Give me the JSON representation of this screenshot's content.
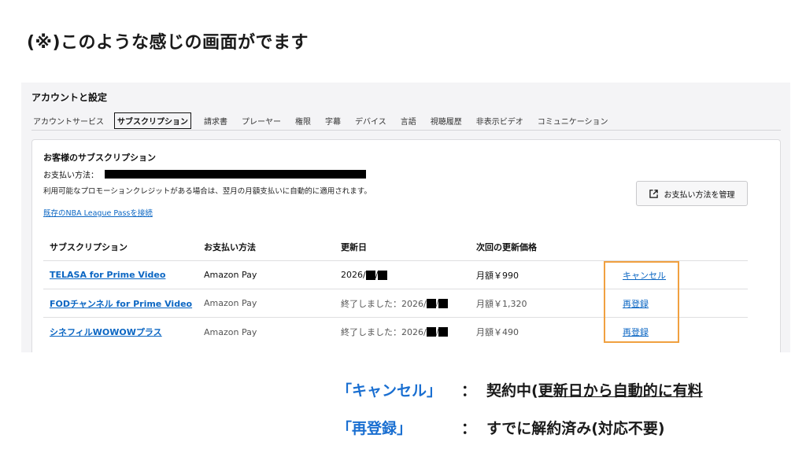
{
  "caption": "(※)このような感じの画面がでます",
  "panel": {
    "title": "アカウントと設定",
    "tabs": [
      "アカウントサービス",
      "サブスクリプション",
      "請求書",
      "プレーヤー",
      "権限",
      "字幕",
      "デバイス",
      "言語",
      "視聴履歴",
      "非表示ビデオ",
      "コミュニケーション"
    ],
    "active_tab": "サブスクリプション"
  },
  "card": {
    "title": "お客様のサブスクリプション",
    "payment_label": "お支払い方法：",
    "promo_note": "利用可能なプロモーションクレジットがある場合は、翌月の月額支払いに自動的に適用されます。",
    "nba_link": "既存のNBA League Passを接続",
    "manage_button": "お支払い方法を管理"
  },
  "table": {
    "headers": [
      "サブスクリプション",
      "お支払い方法",
      "更新日",
      "次回の更新価格"
    ],
    "rows": [
      {
        "name": "TELASA for Prime Video",
        "payment": "Amazon Pay",
        "date_prefix": "2026/",
        "sep": "/",
        "price": "月額￥990",
        "action": "キャンセル"
      },
      {
        "name": "FODチャンネル for Prime Video",
        "payment": "Amazon Pay",
        "date_prefix": "終了しました：2026/",
        "sep": "/",
        "price": "月額￥1,320",
        "action": "再登録"
      },
      {
        "name": "シネフィルWOWOWプラス",
        "payment": "Amazon Pay",
        "date_prefix": "終了しました：2026/",
        "sep": "/",
        "price": "月額￥490",
        "action": "再登録"
      }
    ]
  },
  "legend": {
    "cancel_key": "「キャンセル」",
    "cancel_colon": "：",
    "cancel_desc_a": "契約中(",
    "cancel_desc_b": "更新日から自動的に有料",
    "reregister_key": "「再登録」",
    "reregister_colon": "：",
    "reregister_desc": "すでに解約済み(対応不要)"
  },
  "colors": {
    "link": "#0b66c3",
    "highlight": "#f0a040",
    "legend_key": "#1a6fd1"
  }
}
